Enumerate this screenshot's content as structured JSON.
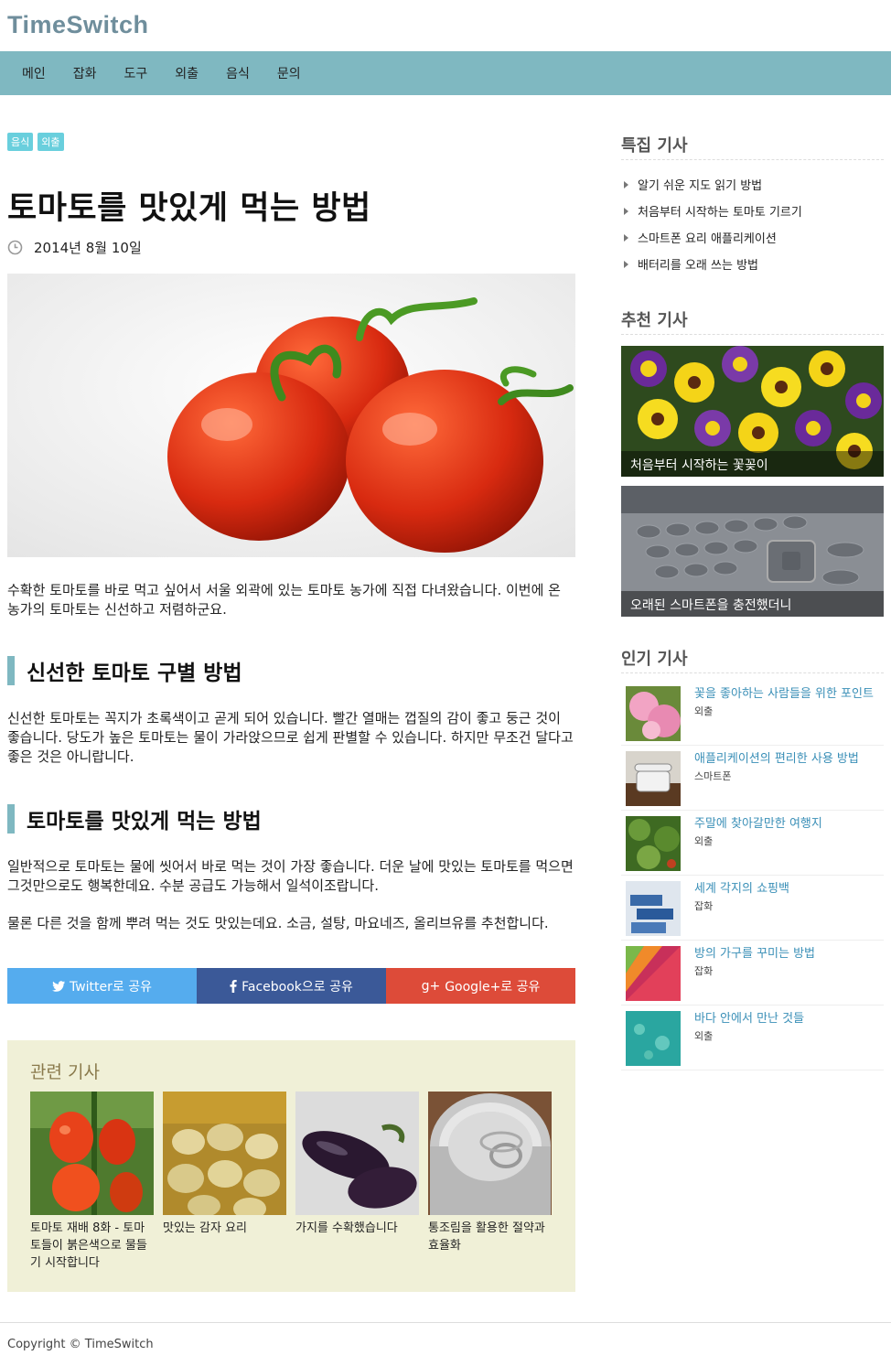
{
  "site": {
    "logo": "TimeSwitch"
  },
  "nav": [
    "메인",
    "잡화",
    "도구",
    "외출",
    "음식",
    "문의"
  ],
  "article": {
    "tags": [
      "음식",
      "외출"
    ],
    "title": "토마토를 맛있게 먹는 방법",
    "date": "2014년 8월 10일",
    "intro": "수확한 토마토를 바로 먹고 싶어서 서울 외곽에 있는 토마토 농가에 직접 다녀왔습니다. 이번에 온 농가의 토마토는 신선하고 저렴하군요.",
    "section1_title": "신선한 토마토 구별 방법",
    "section1_text": "신선한 토마토는 꼭지가 초록색이고 곧게 되어 있습니다. 빨간 열매는 껍질의 감이 좋고 둥근 것이 좋습니다. 당도가 높은 토마토는 물이 가라앉으므로 쉽게 판별할 수 있습니다. 하지만 무조건 달다고 좋은 것은 아니랍니다.",
    "section2_title": "토마토를 맛있게 먹는 방법",
    "section2_text1": "일반적으로 토마토는 물에 씻어서 바로 먹는 것이 가장 좋습니다. 더운 날에 맛있는 토마토를 먹으면 그것만으로도 행복한데요. 수분 공급도 가능해서 일석이조랍니다.",
    "section2_text2": "물론 다른 것을 함께 뿌려 먹는 것도 맛있는데요. 소금, 설탕, 마요네즈, 올리브유를 추천합니다."
  },
  "share": {
    "twitter": "Twitter로 공유",
    "facebook": "Facebook으로 공유",
    "google": "Google+로 공유"
  },
  "related": {
    "title": "관련 기사",
    "items": [
      "토마토 재배 8화 - 토마토들이 붉은색으로 물들기 시작합니다",
      "맛있는 감자 요리",
      "가지를 수확했습니다",
      "통조림을 활용한 절약과 효율화"
    ]
  },
  "sidebar": {
    "featured_title": "특집 기사",
    "featured": [
      "알기 쉬운 지도 읽기 방법",
      "처음부터 시작하는 토마토 기르기",
      "스마트폰 요리 애플리케이션",
      "배터리를 오래 쓰는 방법"
    ],
    "recommended_title": "추천 기사",
    "recommended": [
      "처음부터 시작하는 꽃꽂이",
      "오래된 스마트폰을 충전했더니"
    ],
    "popular_title": "인기 기사",
    "popular": [
      {
        "title": "꽃을 좋아하는 사람들을 위한 포인트",
        "category": "외출"
      },
      {
        "title": "애플리케이션의 편리한 사용 방법",
        "category": "스마트폰"
      },
      {
        "title": "주말에 찾아갈만한 여행지",
        "category": "외출"
      },
      {
        "title": "세계 각지의 쇼핑백",
        "category": "잡화"
      },
      {
        "title": "방의 가구를 꾸미는 방법",
        "category": "잡화"
      },
      {
        "title": "바다 안에서 만난 것들",
        "category": "외출"
      }
    ]
  },
  "footer": {
    "copyright": "Copyright © TimeSwitch"
  },
  "colors": {
    "nav_bg": "#7fb8c1",
    "tag_bg": "#69cfdd",
    "twitter": "#55acee",
    "facebook": "#3b5998",
    "google": "#dd4b39",
    "related_bg": "#f0f0d7",
    "link": "#3a8fb7"
  }
}
